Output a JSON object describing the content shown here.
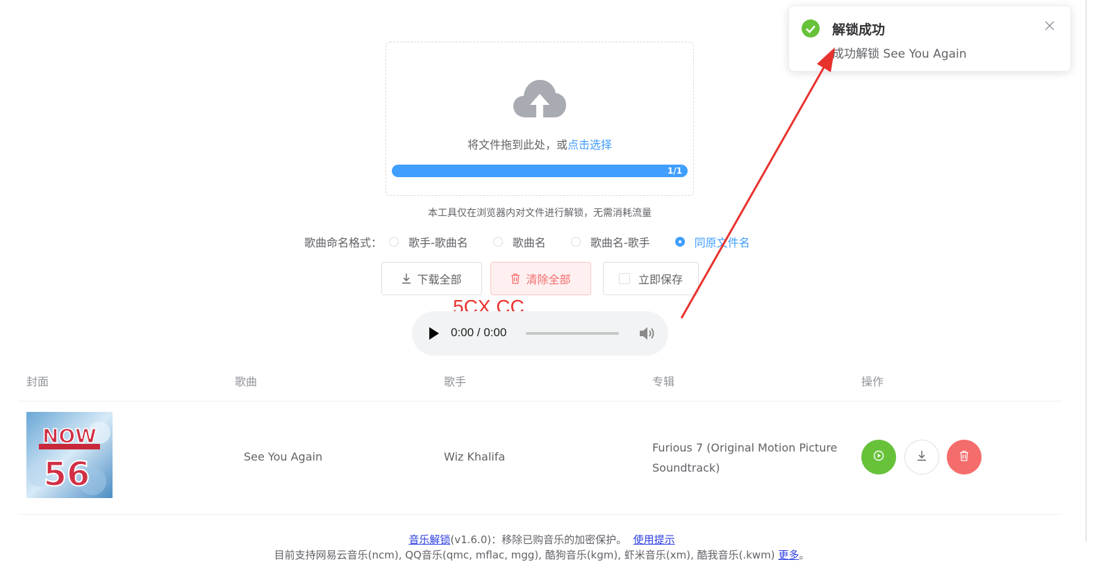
{
  "upload": {
    "drag_text": "将文件拖到此处，或",
    "click_link": "点击选择",
    "progress_fraction": 1.0,
    "progress_text": "1/1"
  },
  "tip_text": "本工具仅在浏览器内对文件进行解锁，无需消耗流量",
  "naming": {
    "label": "歌曲命名格式：",
    "options": [
      {
        "label": "歌手-歌曲名",
        "checked": false
      },
      {
        "label": "歌曲名",
        "checked": false
      },
      {
        "label": "歌曲名-歌手",
        "checked": false
      },
      {
        "label": "同原文件名",
        "checked": true
      }
    ]
  },
  "buttons": {
    "download_all": "下载全部",
    "clear_all": "清除全部",
    "save_now": "立即保存"
  },
  "watermark": "5CX.CC",
  "audio": {
    "time": "0:00 / 0:00"
  },
  "table": {
    "headers": {
      "cover": "封面",
      "title": "歌曲",
      "artist": "歌手",
      "album": "专辑",
      "actions": "操作"
    },
    "rows": [
      {
        "cover_text": "NOW",
        "cover_number": "56",
        "title": "See You Again",
        "artist": "Wiz Khalifa",
        "album": "Furious 7 (Original Motion Picture Soundtrack)"
      }
    ]
  },
  "footer": {
    "app_link": "音乐解锁",
    "version_text": "(v1.6.0)：移除已购音乐的加密保护。",
    "tips_link": "使用提示",
    "supported_text": "目前支持网易云音乐(ncm), QQ音乐(qmc, mflac, mgg), 酷狗音乐(kgm), 虾米音乐(xm), 酷我音乐(.kwm)",
    "more_link": "更多",
    "period": "。"
  },
  "notification": {
    "title": "解锁成功",
    "message": "成功解锁 See You Again"
  },
  "colors": {
    "primary": "#409eff",
    "success": "#67c23a",
    "danger": "#f56c6c",
    "arrow": "#e8322e"
  },
  "icons": {
    "upload": "cloud-upload-icon",
    "download": "download-icon",
    "delete": "trash-icon",
    "play": "play-icon",
    "volume": "volume-icon",
    "success": "check-circle-icon",
    "close": "close-icon"
  }
}
